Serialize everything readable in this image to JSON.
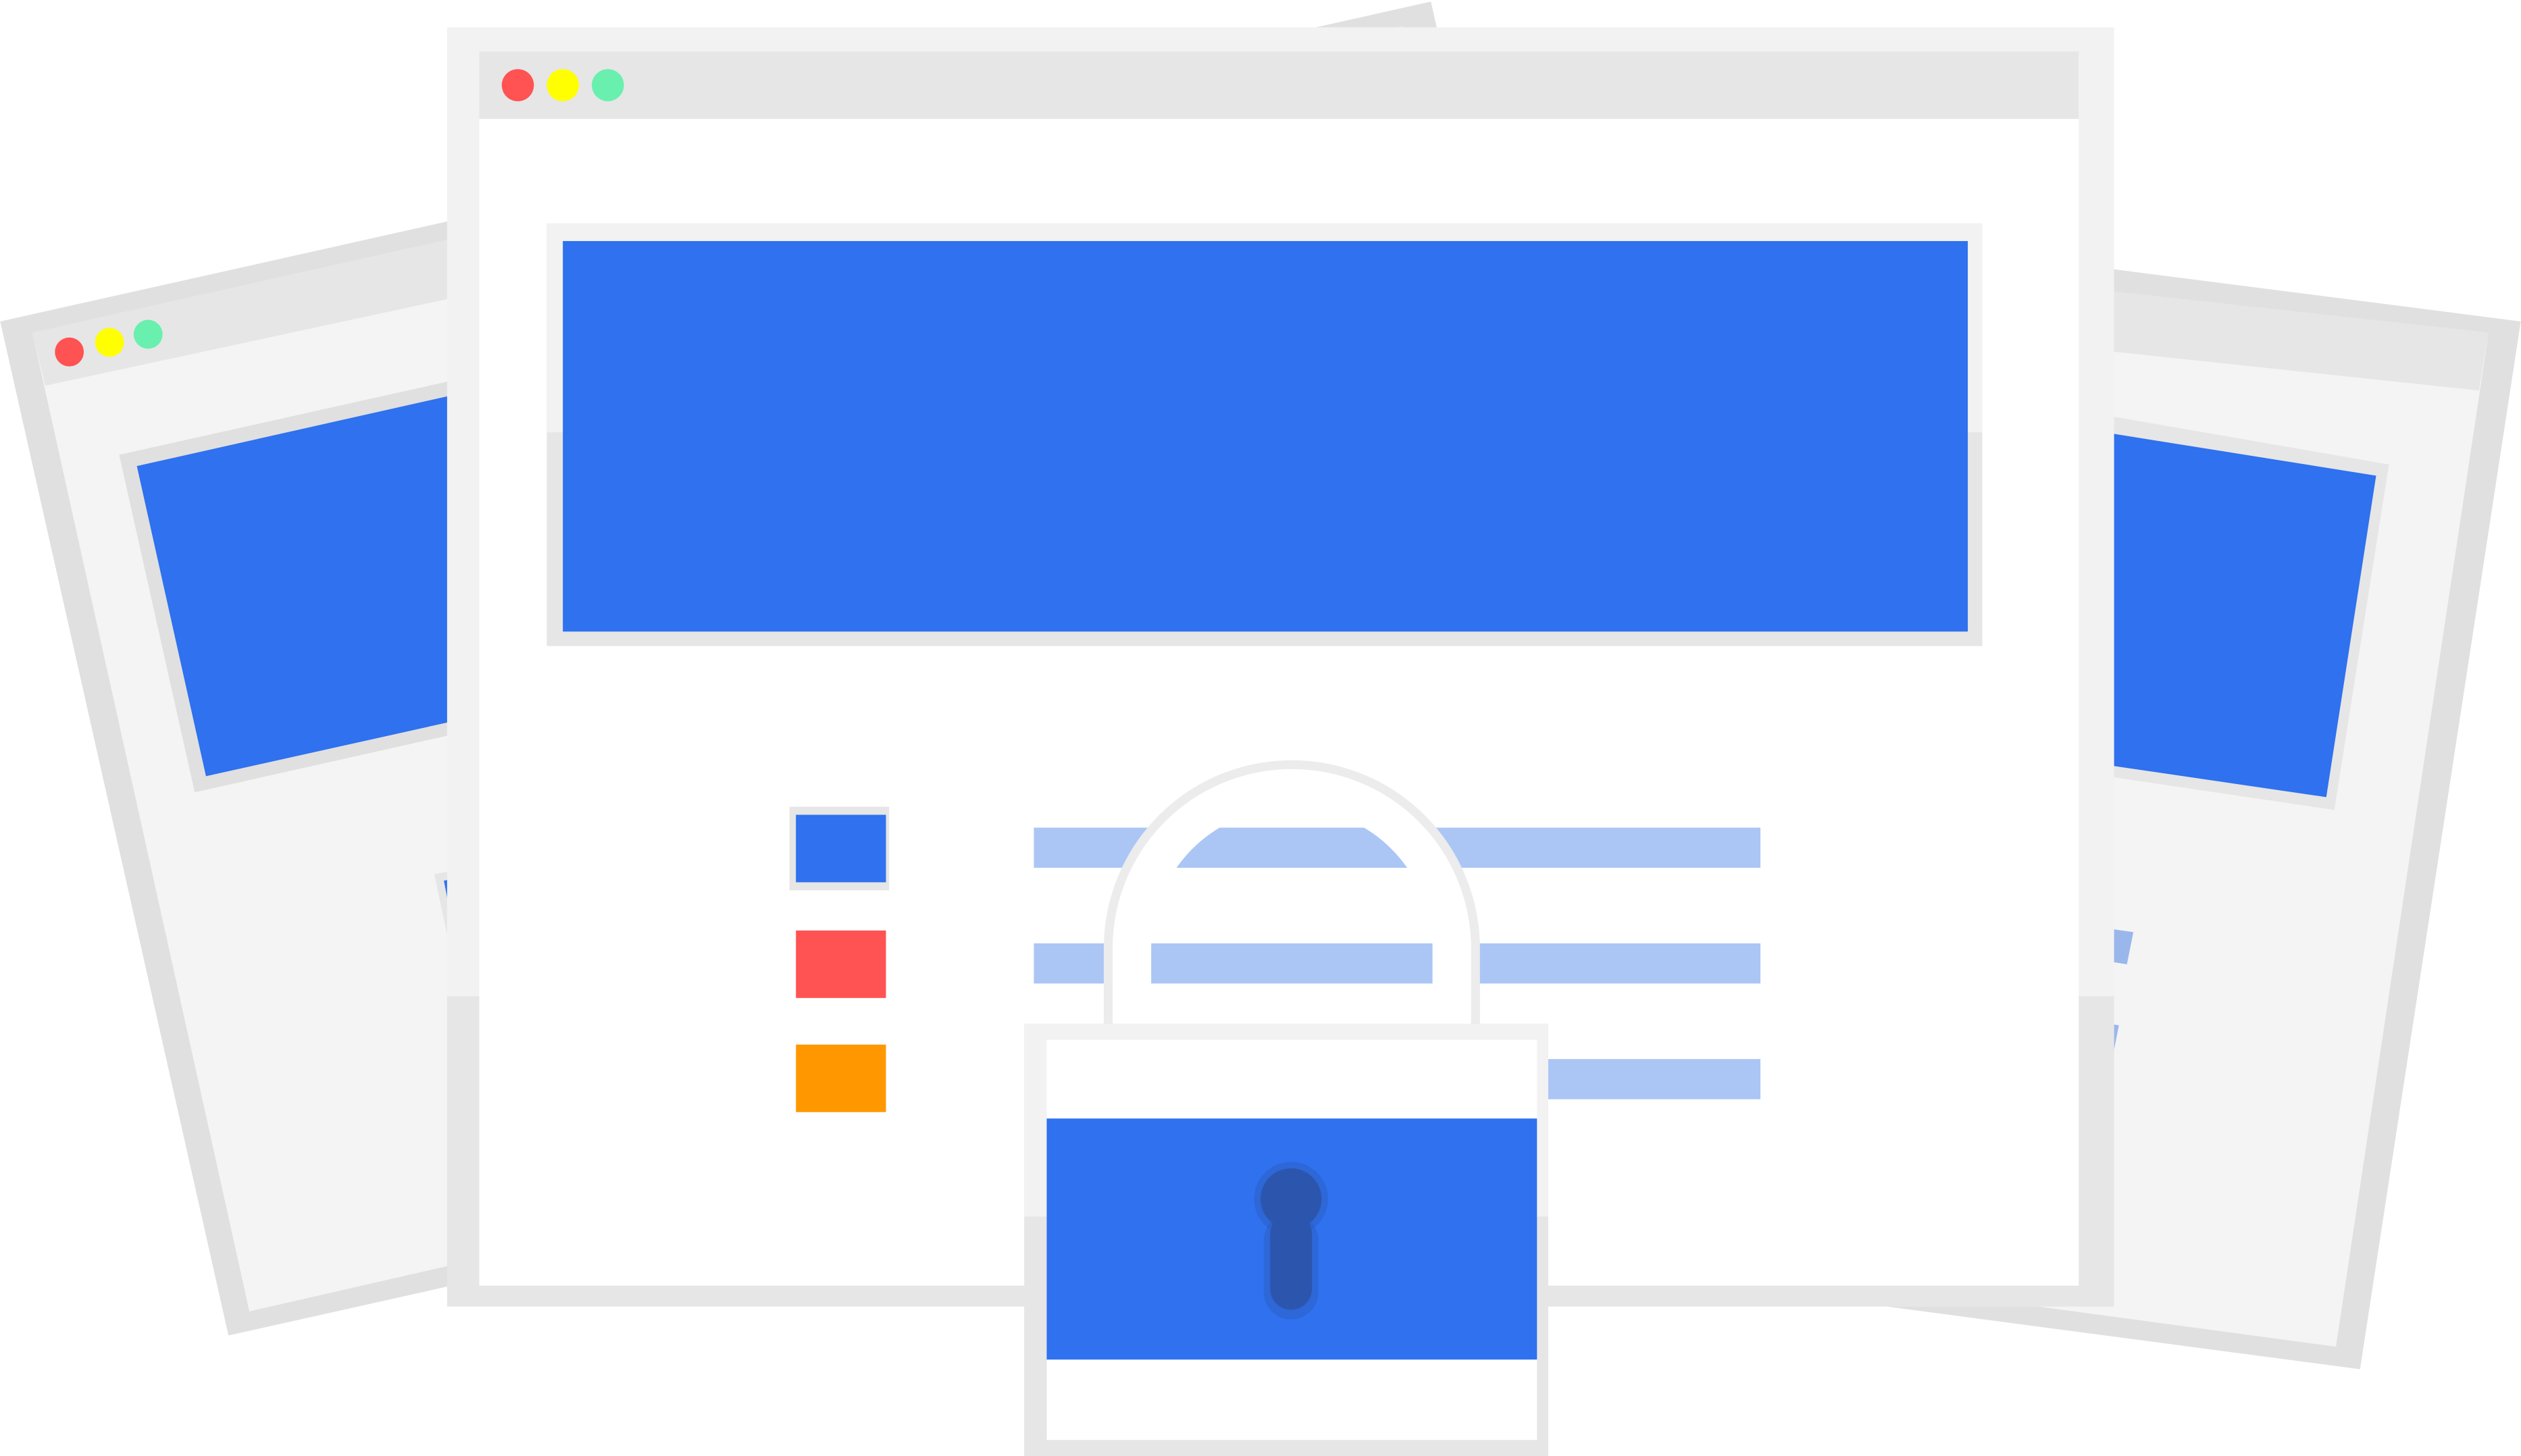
{
  "illustration": {
    "windows": [
      {
        "name": "back-left-window",
        "traffic_lights": [
          "#ff5252",
          "#ffff00",
          "#69f0ae"
        ]
      },
      {
        "name": "main-window",
        "traffic_lights": [
          "#ff5252",
          "#ffff00",
          "#69f0ae"
        ]
      },
      {
        "name": "back-right-window",
        "traffic_lights": []
      }
    ],
    "list_item_colors": [
      "#2f71ee",
      "#ff5252",
      "#ff9800"
    ],
    "icons": [
      "padlock-icon",
      "keyhole-icon"
    ]
  },
  "colors": {
    "accent_blue": "#2f71ee",
    "text_placeholder": "#abc6f5",
    "window_frame": "#f2f2f2",
    "window_frame_shadow": "#e0e0e0",
    "titlebar": "#e6e6e6",
    "window_body": "#ffffff",
    "back_window_body": "#f4f4f4",
    "keyhole": "#2c56ae"
  }
}
